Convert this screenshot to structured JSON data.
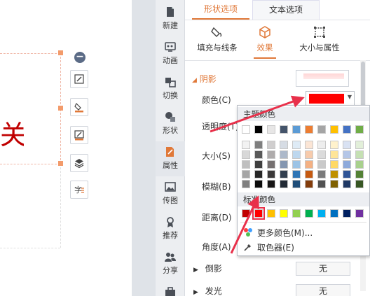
{
  "canvas": {
    "glyph": "关"
  },
  "sidebar": {
    "items": [
      {
        "label": "新建",
        "icon": "new-doc-icon"
      },
      {
        "label": "动画",
        "icon": "animation-icon"
      },
      {
        "label": "切换",
        "icon": "transition-icon"
      },
      {
        "label": "形状",
        "icon": "shapes-icon"
      },
      {
        "label": "属性",
        "icon": "properties-icon"
      },
      {
        "label": "传图",
        "icon": "upload-image-icon"
      },
      {
        "label": "推荐",
        "icon": "recommend-icon"
      },
      {
        "label": "分享",
        "icon": "share-icon"
      }
    ]
  },
  "panel": {
    "tabs": [
      "形状选项",
      "文本选项"
    ],
    "subtabs": [
      "填充与线条",
      "效果",
      "大小与属性"
    ],
    "section": "阴影",
    "props": {
      "color": "颜色(C)",
      "transparency": "透明度(T)",
      "size": "大小(S)",
      "blur": "模糊(B)",
      "distance": "距离(D)",
      "angle": "角度(A)"
    },
    "reflection": "倒影",
    "glow": "发光",
    "none_value": "无"
  },
  "color_popup": {
    "theme_title": "主题颜色",
    "standard_title": "标准颜色",
    "more_colors": "更多颜色(M)...",
    "eyedropper": "取色器(E)",
    "selected_color": "#ff0000",
    "theme_colors": [
      "#ffffff",
      "#000000",
      "#e7e6e6",
      "#44546a",
      "#5b9bd5",
      "#ed7d31",
      "#a5a5a5",
      "#ffc000",
      "#4472c4",
      "#70ad47"
    ],
    "theme_shades": [
      [
        "#f2f2f2",
        "#7f7f7f",
        "#d0cece",
        "#d6dce4",
        "#deebf6",
        "#fbe5d5",
        "#ededed",
        "#fff2cc",
        "#d9e2f3",
        "#e2efd9"
      ],
      [
        "#d8d8d8",
        "#595959",
        "#aeabab",
        "#adb9ca",
        "#bdd7ee",
        "#f7cbac",
        "#dbdbdb",
        "#fee599",
        "#b4c6e7",
        "#c5e0b3"
      ],
      [
        "#bfbfbf",
        "#3f3f3f",
        "#757070",
        "#8496b0",
        "#9cc3e5",
        "#f4b183",
        "#c9c9c9",
        "#ffd965",
        "#8eaadb",
        "#a8d08d"
      ],
      [
        "#a5a5a5",
        "#262626",
        "#3a3838",
        "#323f4f",
        "#2e75b5",
        "#c55a11",
        "#7b7b7b",
        "#bf9000",
        "#2f5496",
        "#538135"
      ],
      [
        "#7f7f7f",
        "#0c0c0c",
        "#171616",
        "#222a35",
        "#1f4e79",
        "#833c0b",
        "#525252",
        "#7f6000",
        "#1f3864",
        "#375623"
      ]
    ],
    "standard_colors": [
      "#c00000",
      "#ff0000",
      "#ffc000",
      "#ffff00",
      "#92d050",
      "#00b050",
      "#00b0f0",
      "#0070c0",
      "#002060",
      "#7030a0"
    ]
  },
  "colors": {
    "accent": "#e07838",
    "annotation_arrow": "#e8304a"
  }
}
